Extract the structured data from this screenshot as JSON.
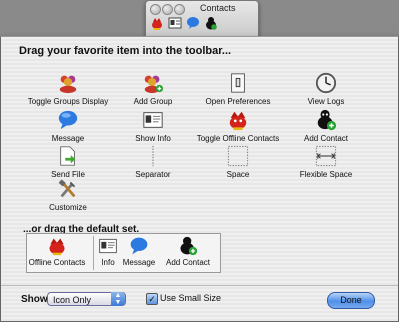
{
  "bg_window": {
    "title": "Contacts"
  },
  "sheet": {
    "heading": "Drag your favorite item into the toolbar...",
    "items": [
      {
        "label": "Toggle Groups Display",
        "icon": "people-icon"
      },
      {
        "label": "Add Group",
        "icon": "add-group-icon"
      },
      {
        "label": "Open Preferences",
        "icon": "light-switch-icon"
      },
      {
        "label": "View Logs",
        "icon": "clock-icon"
      },
      {
        "label": "Message",
        "icon": "speech-bubble-icon"
      },
      {
        "label": "Show Info",
        "icon": "id-card-icon"
      },
      {
        "label": "Toggle Offline Contacts",
        "icon": "red-duck-icon"
      },
      {
        "label": "Add Contact",
        "icon": "add-contact-icon"
      },
      {
        "label": "Send File",
        "icon": "send-file-icon"
      },
      {
        "label": "Separator",
        "icon": "separator-icon"
      },
      {
        "label": "Space",
        "icon": "space-icon"
      },
      {
        "label": "Flexible Space",
        "icon": "flexible-space-icon"
      },
      {
        "label": "Customize",
        "icon": "tools-icon"
      }
    ],
    "default_heading": "...or drag the default set.",
    "default_set": [
      {
        "label": "Offline Contacts",
        "icon": "red-duck-icon"
      },
      {
        "label": "Info",
        "icon": "id-card-icon"
      },
      {
        "label": "Message",
        "icon": "speech-bubble-icon"
      },
      {
        "label": "Add Contact",
        "icon": "add-contact-icon"
      }
    ]
  },
  "footer": {
    "show_label": "Show",
    "show_value": "Icon Only",
    "small_size_label": "Use Small Size",
    "small_size_checked": true,
    "done_label": "Done"
  }
}
